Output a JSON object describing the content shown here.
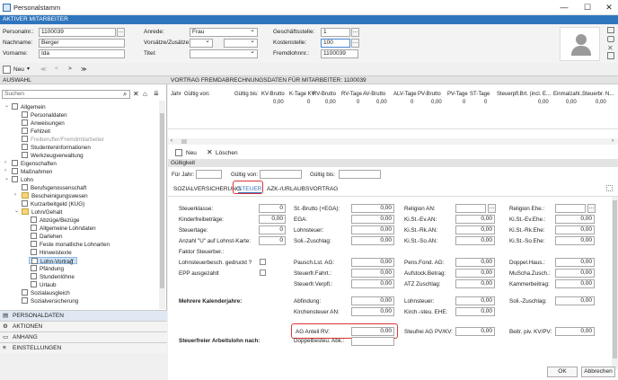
{
  "window": {
    "title": "Personalstamm"
  },
  "employee_bar": "AKTIVER MITARBEITER",
  "header": {
    "personalnr_label": "Personalnr.:",
    "personalnr": "1100039",
    "nachname_label": "Nachname:",
    "nachname": "Berger",
    "vorname_label": "Vorname:",
    "vorname": "Ida",
    "anrede_label": "Anrede:",
    "anrede": "Frau",
    "vorsaetze_label": "Vorsätze/Zusätze:",
    "titel_label": "Titel:",
    "geschaeftsstelle_label": "Geschäftsstelle:",
    "geschaeftsstelle": "1",
    "kostenstelle_label": "Kostenstelle:",
    "kostenstelle": "100",
    "fremdlohnnr_label": "Fremdlohnnr.:",
    "fremdlohnnr": "1100039"
  },
  "toolbar": {
    "new_label": "Neu",
    "nav": [
      "≪",
      "<",
      ">",
      "≫"
    ]
  },
  "left": {
    "section": "AUSWAHL",
    "search_placeholder": "Suchen",
    "tree": [
      "Allgemein",
      "Personaldaten",
      "Anweisungen",
      "Fehlzeit",
      "Freiberufler/Fremdmitarbeiter",
      "Studenteninformationen",
      "Werkzeugverwaltung",
      "Eigenschaften",
      "Maßnahmen",
      "Lohn",
      "Berufsgenossenschaft",
      "Bescheinigungswesen",
      "Kurzarbeitgeld (KUG)",
      "Lohn/Gehalt",
      "Abzüge/Bezüge",
      "Allgemeine Lohndaten",
      "Darlehen",
      "Feste monatliche Lohnarten",
      "Hinweistexte",
      "Lohn-Vortrag",
      "Pfändung",
      "Stundenlöhne",
      "Urlaub",
      "Sozialausgleich",
      "Sozialversicherung"
    ],
    "nav_sections": [
      "PERSONALDATEN",
      "AKTIONEN",
      "ANHANG",
      "EINSTELLUNGEN"
    ]
  },
  "right": {
    "section": "VORTRAG FREMDABRECHNUNGSDATEN FÜR MITARBEITER: 1100039",
    "grid_headers": [
      "Jahr",
      "Gültig von:",
      "Gültig bis:",
      "KV-Brutto",
      "K-Tage KV",
      "RV-Brutto",
      "RV-Tage",
      "AV-Brutto",
      "ALV-Tage",
      "PV-Brutto",
      "PV-Tage",
      "ST-Tage",
      "Steuerpfl.Brt. (incl. E...",
      "Einmalzahl...",
      "Steuerbr. N..."
    ],
    "grid_row": [
      "",
      "",
      "",
      "0,00",
      "0",
      "0,00",
      "0",
      "0,00",
      "0",
      "0,00",
      "0",
      "0",
      "0,00",
      "0,00",
      "0,00"
    ],
    "new_label": "Neu",
    "delete_label": "Löschen",
    "validity_section": "Gültigkeit",
    "fuer_jahr_label": "Für Jahr:",
    "gueltig_von_label": "Gültig von:",
    "gueltig_bis_label": "Gültig bis:",
    "tabs": [
      "SOZIALVERSICHERUNG",
      "STEUER",
      "AZK-/URLAUBSVORTRAG"
    ],
    "col1": [
      {
        "label": "Steuerklasse:",
        "value": "0"
      },
      {
        "label": "Kinderfreibeträge:",
        "value": "0,00"
      },
      {
        "label": "Steuertage:",
        "value": "0"
      },
      {
        "label": "Anzahl \"U\" auf Lohnst-Karte:",
        "value": "0"
      },
      {
        "label": "Faktor Steuerber.:",
        "value": ""
      }
    ],
    "lohnsteuerbesch_label": "Lohnsteuerbesch. gedruckt ?",
    "epp_label": "EPP ausgezahlt",
    "mehrere_label": "Mehrere Kalenderjahre:",
    "steuerfrei_label": "Steuerfreier Arbeitslohn nach:",
    "col2": [
      {
        "label": "St.-Brutto (+EGA):",
        "value": "0,00"
      },
      {
        "label": "EGA:",
        "value": "0,00"
      },
      {
        "label": "Lohnsteuer:",
        "value": "0,00"
      },
      {
        "label": "Soli.-Zuschlag:",
        "value": "0,00"
      },
      {
        "label": "Pausch.Lst. AG:",
        "value": "0,00"
      },
      {
        "label": "Steuerfr.Fahrt.:",
        "value": "0,00"
      },
      {
        "label": "Steuerfr.Verpfl.:",
        "value": "0,00"
      },
      {
        "label": "Abfindung:",
        "value": "0,00"
      },
      {
        "label": "Kirchensteuer AN:",
        "value": "0,00"
      },
      {
        "label": "AG Anteil RV:",
        "value": "0,00"
      },
      {
        "label": "Doppelbesteu. Abk.:",
        "value": ""
      }
    ],
    "col3": [
      {
        "label": "Religion AN:",
        "value": ""
      },
      {
        "label": "Ki.St.-Ev.AN:",
        "value": "0,00"
      },
      {
        "label": "Ki.St.-Rk.AN:",
        "value": "0,00"
      },
      {
        "label": "Ki.St.-So.AN:",
        "value": "0,00"
      },
      {
        "label": "Pens.Fond. AG:",
        "value": "0,00"
      },
      {
        "label": "Aufstock.Betrag:",
        "value": "0,00"
      },
      {
        "label": "ATZ Zuschlag:",
        "value": "0,00"
      },
      {
        "label": "Lohnsteuer:",
        "value": "0,00"
      },
      {
        "label": "Kirch.-steu. EHE:",
        "value": "0,00"
      },
      {
        "label": "Steufrei AG PV/KV:",
        "value": "0,00"
      }
    ],
    "col4": [
      {
        "label": "Religion Ehe.:",
        "value": ""
      },
      {
        "label": "Ki.St.-Ev.Ehe.:",
        "value": "0,00"
      },
      {
        "label": "Ki.St.-Rk.Ehe:",
        "value": "0,00"
      },
      {
        "label": "Ki.St.-So.Ehe:",
        "value": "0,00"
      },
      {
        "label": "Doppel.Haus.:",
        "value": "0,00"
      },
      {
        "label": "MuScha.Zusch.:",
        "value": "0,00"
      },
      {
        "label": "Kammerbeitrag:",
        "value": "0,00"
      },
      {
        "label": "Soli.-Zuschlag:",
        "value": "0,00"
      },
      {
        "label": "Beitr. piv. KV/PV:",
        "value": "0,00"
      }
    ],
    "ok_label": "OK",
    "cancel_label": "Abbrechen"
  }
}
